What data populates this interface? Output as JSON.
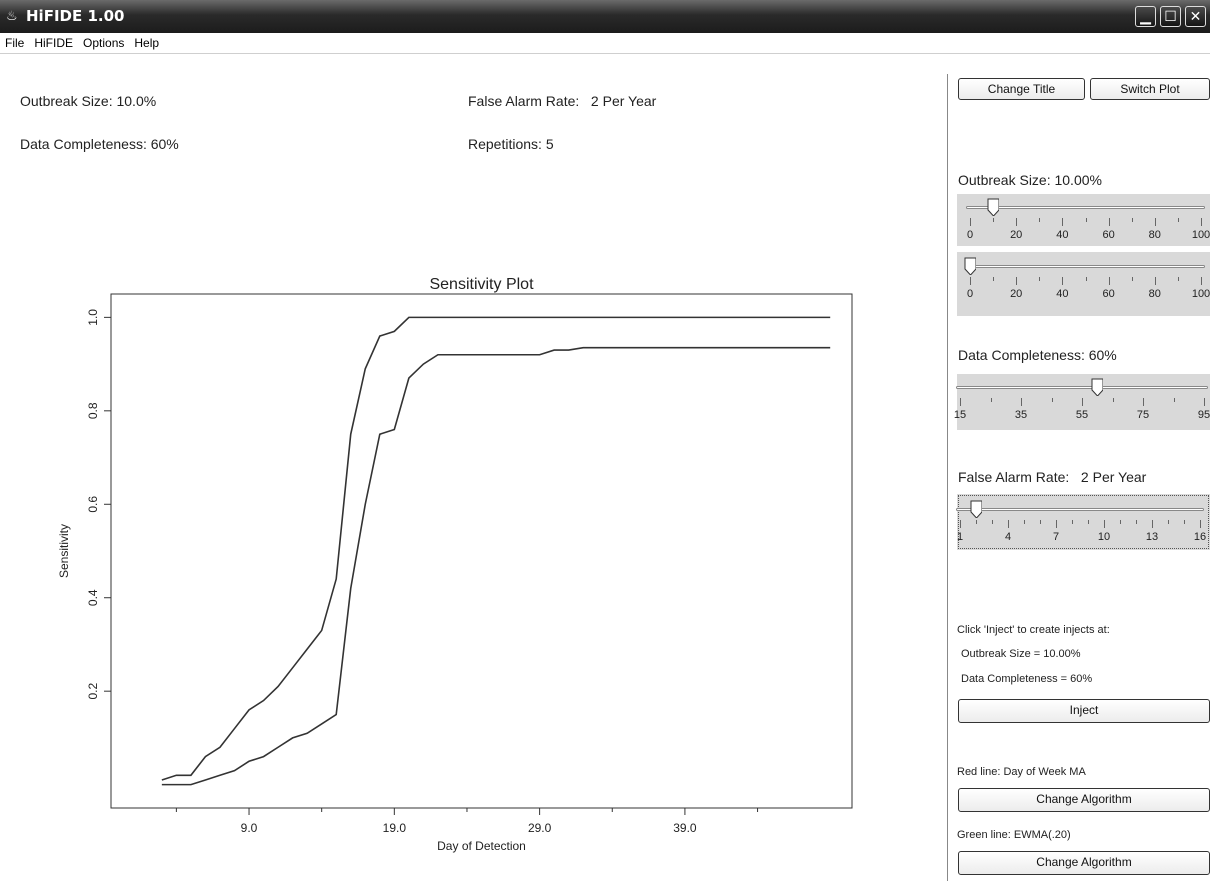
{
  "window": {
    "title": "HiFIDE 1.00"
  },
  "menu": [
    "File",
    "HiFIDE",
    "Options",
    "Help"
  ],
  "info": {
    "outbreak": "Outbreak Size: 10.0%",
    "false_alarm": "False Alarm Rate:   2 Per Year",
    "completeness": "Data Completeness: 60%",
    "repetitions": "Repetitions: 5"
  },
  "panel": {
    "change_title": "Change Title",
    "switch_plot": "Switch Plot",
    "outbreak_label": "Outbreak Size:  10.00%",
    "outbreak_value": 10,
    "outbreak_ticks": [
      "0",
      "20",
      "40",
      "60",
      "80",
      "100"
    ],
    "outbreak2_value": 0,
    "outbreak2_ticks": [
      "0",
      "20",
      "40",
      "60",
      "80",
      "100"
    ],
    "completeness_label": "Data Completeness:  60%",
    "completeness_value": 60,
    "completeness_ticks": [
      "15",
      "35",
      "55",
      "75",
      "95"
    ],
    "far_label": "False Alarm Rate:   2 Per Year",
    "far_value": 2,
    "far_ticks": [
      "1",
      "4",
      "7",
      "10",
      "13",
      "16"
    ],
    "inject_note": "Click 'Inject' to create injects at:",
    "inject_outbreak": "Outbreak Size = 10.00%",
    "inject_completeness": "Data Completeness = 60%",
    "inject_button": "Inject",
    "red_line": "Red line: Day of Week MA",
    "change_algorithm_1": "Change Algorithm",
    "green_line": "Green line: EWMA(.20)",
    "change_algorithm_2": "Change Algorithm"
  },
  "chart_data": {
    "type": "line",
    "title": "Sensitivity Plot",
    "xlabel": "Day of Detection",
    "ylabel": "Sensitivity",
    "xlim": [
      -0.5,
      50.5
    ],
    "ylim": [
      -0.05,
      1.05
    ],
    "xticks": [
      9.0,
      19.0,
      29.0,
      39.0
    ],
    "xtick_labels": [
      "9.0",
      "19.0",
      "29.0",
      "39.0"
    ],
    "yticks": [
      0.2,
      0.4,
      0.6,
      0.8,
      1.0
    ],
    "ytick_labels": [
      "0.2",
      "0.4",
      "0.6",
      "0.8",
      "1.0"
    ],
    "color": "#333333",
    "series": [
      {
        "x": [
          3,
          4,
          5,
          6,
          7,
          8,
          9,
          10,
          11,
          12,
          13,
          14,
          15,
          16,
          17,
          18,
          19,
          20,
          21,
          22,
          23,
          24,
          25,
          26,
          27,
          28,
          29,
          30,
          31,
          32,
          33,
          34,
          35,
          36,
          37,
          38,
          39,
          40,
          41,
          42,
          43,
          44,
          45,
          46,
          47,
          48,
          49
        ],
        "values": [
          0.01,
          0.02,
          0.02,
          0.06,
          0.08,
          0.12,
          0.16,
          0.18,
          0.21,
          0.25,
          0.29,
          0.33,
          0.44,
          0.75,
          0.89,
          0.96,
          0.97,
          1.0,
          1.0,
          1.0,
          1.0,
          1.0,
          1.0,
          1.0,
          1.0,
          1.0,
          1.0,
          1.0,
          1.0,
          1.0,
          1.0,
          1.0,
          1.0,
          1.0,
          1.0,
          1.0,
          1.0,
          1.0,
          1.0,
          1.0,
          1.0,
          1.0,
          1.0,
          1.0,
          1.0,
          1.0,
          1.0
        ]
      },
      {
        "x": [
          3,
          4,
          5,
          6,
          7,
          8,
          9,
          10,
          11,
          12,
          13,
          14,
          15,
          16,
          17,
          18,
          19,
          20,
          21,
          22,
          23,
          24,
          25,
          26,
          27,
          28,
          29,
          30,
          31,
          32,
          33,
          34,
          35,
          36,
          37,
          38,
          39,
          40,
          41,
          42,
          43,
          44,
          45,
          46,
          47,
          48,
          49
        ],
        "values": [
          0.0,
          0.0,
          0.0,
          0.01,
          0.02,
          0.03,
          0.05,
          0.06,
          0.08,
          0.1,
          0.11,
          0.13,
          0.15,
          0.42,
          0.6,
          0.75,
          0.76,
          0.87,
          0.9,
          0.92,
          0.92,
          0.92,
          0.92,
          0.92,
          0.92,
          0.92,
          0.92,
          0.93,
          0.93,
          0.935,
          0.935,
          0.935,
          0.935,
          0.935,
          0.935,
          0.935,
          0.935,
          0.935,
          0.935,
          0.935,
          0.935,
          0.935,
          0.935,
          0.935,
          0.935,
          0.935,
          0.935
        ]
      }
    ]
  }
}
